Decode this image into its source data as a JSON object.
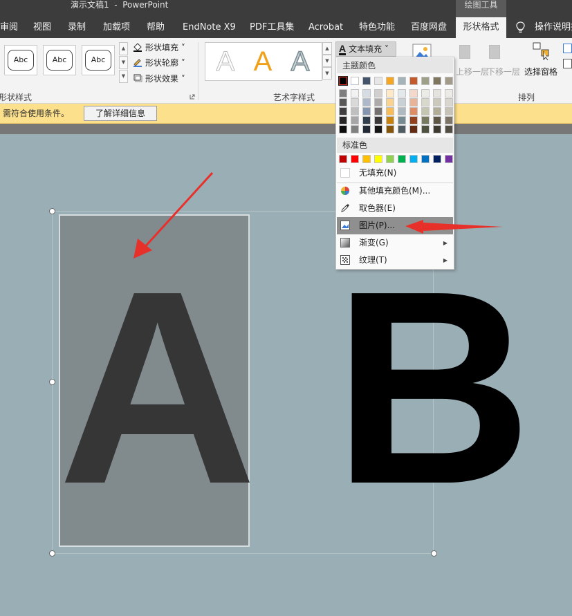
{
  "titlebar": {
    "title": "演示文稿1  -  PowerPoint",
    "context_tab": "绘图工具"
  },
  "tabs": [
    {
      "label": "审阅"
    },
    {
      "label": "视图"
    },
    {
      "label": "录制"
    },
    {
      "label": "加载项"
    },
    {
      "label": "帮助"
    },
    {
      "label": "EndNote X9"
    },
    {
      "label": "PDF工具集"
    },
    {
      "label": "Acrobat"
    },
    {
      "label": "特色功能"
    },
    {
      "label": "百度网盘"
    },
    {
      "label": "形状格式"
    },
    {
      "label": "操作说明搜"
    }
  ],
  "ribbon": {
    "shape_styles": {
      "samples": [
        "Abc",
        "Abc",
        "Abc"
      ],
      "group_label": "形状样式"
    },
    "shape_format": {
      "fill": "形状填充",
      "outline": "形状轮廓",
      "effects": "形状效果"
    },
    "wordart": {
      "samples": [
        "A",
        "A",
        "A"
      ],
      "group_label": "艺术字样式",
      "text_fill": "文本填充"
    },
    "arrange": {
      "bring_forward": "上移一层",
      "send_backward": "下移一层",
      "selection_pane": "选择窗格",
      "group_label": "排列"
    }
  },
  "message_bar": {
    "text": "需符合使用条件。",
    "button": "了解详细信息"
  },
  "slide": {
    "letter_a": "A",
    "letter_b": "B"
  },
  "dropdown": {
    "theme_header": "主题颜色",
    "standard_header": "标准色",
    "theme_top": [
      "#000000",
      "#ffffff",
      "#44546a",
      "#e7e6e6",
      "#f5a623",
      "#a5b4b9",
      "#c55a2a",
      "#9ea089",
      "#7f7660",
      "#a39b8a"
    ],
    "theme_shades": [
      [
        "#7f7f7f",
        "#f2f2f2",
        "#d6dce4",
        "#d0cece",
        "#fde9c8",
        "#e3e8ea",
        "#f4d9cb",
        "#ebece5",
        "#e5e3dd",
        "#ecebe7"
      ],
      [
        "#595959",
        "#d9d9d9",
        "#adb9ca",
        "#aeaaaa",
        "#fbd391",
        "#c8d1d5",
        "#e9b397",
        "#d8d9cb",
        "#ccc8bb",
        "#d9d6cf"
      ],
      [
        "#3f3f3f",
        "#bfbfbf",
        "#8496b0",
        "#757171",
        "#f9bc5a",
        "#aebac0",
        "#df8d64",
        "#c4c6b1",
        "#b2ad98",
        "#c6c2b7"
      ],
      [
        "#262626",
        "#a6a6a6",
        "#323f4f",
        "#3a3838",
        "#c8800e",
        "#778b93",
        "#93411c",
        "#777960",
        "#5f5848",
        "#7c7567"
      ],
      [
        "#0d0d0d",
        "#808080",
        "#222a35",
        "#171616",
        "#855509",
        "#4f5d62",
        "#622b12",
        "#4f5140",
        "#3f3b30",
        "#534e44"
      ]
    ],
    "standard": [
      "#c00000",
      "#ff0000",
      "#ffc000",
      "#ffff00",
      "#92d050",
      "#00b050",
      "#00b0f0",
      "#0070c0",
      "#002060",
      "#7030a0"
    ],
    "no_fill": "无填充(N)",
    "more_colors": "其他填充颜色(M)...",
    "eyedropper": "取色器(E)",
    "picture": "图片(P)...",
    "gradient": "渐变(G)",
    "texture": "纹理(T)"
  }
}
